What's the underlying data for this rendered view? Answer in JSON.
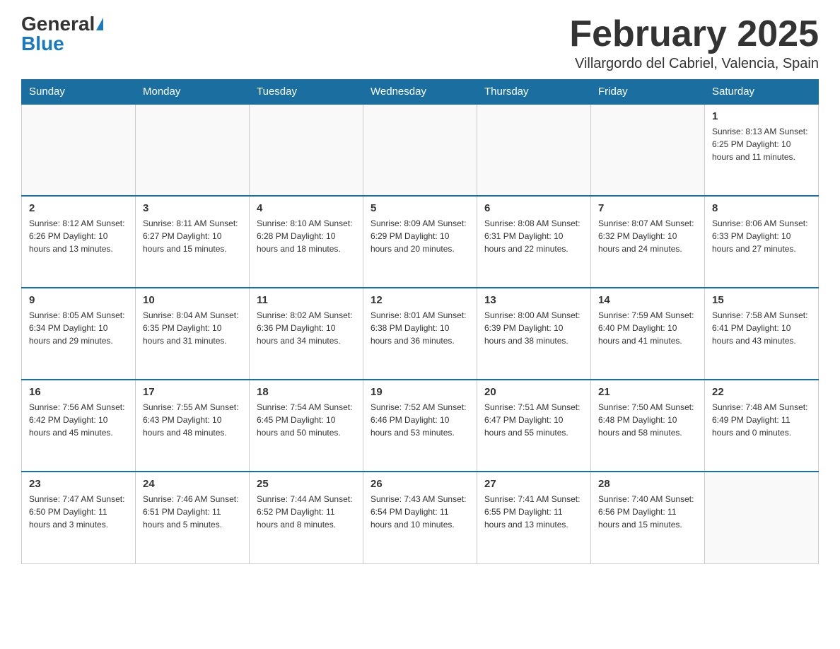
{
  "header": {
    "logo_general": "General",
    "logo_blue": "Blue",
    "month_title": "February 2025",
    "location": "Villargordo del Cabriel, Valencia, Spain"
  },
  "weekdays": [
    "Sunday",
    "Monday",
    "Tuesday",
    "Wednesday",
    "Thursday",
    "Friday",
    "Saturday"
  ],
  "weeks": [
    [
      {
        "day": "",
        "info": ""
      },
      {
        "day": "",
        "info": ""
      },
      {
        "day": "",
        "info": ""
      },
      {
        "day": "",
        "info": ""
      },
      {
        "day": "",
        "info": ""
      },
      {
        "day": "",
        "info": ""
      },
      {
        "day": "1",
        "info": "Sunrise: 8:13 AM\nSunset: 6:25 PM\nDaylight: 10 hours and 11 minutes."
      }
    ],
    [
      {
        "day": "2",
        "info": "Sunrise: 8:12 AM\nSunset: 6:26 PM\nDaylight: 10 hours and 13 minutes."
      },
      {
        "day": "3",
        "info": "Sunrise: 8:11 AM\nSunset: 6:27 PM\nDaylight: 10 hours and 15 minutes."
      },
      {
        "day": "4",
        "info": "Sunrise: 8:10 AM\nSunset: 6:28 PM\nDaylight: 10 hours and 18 minutes."
      },
      {
        "day": "5",
        "info": "Sunrise: 8:09 AM\nSunset: 6:29 PM\nDaylight: 10 hours and 20 minutes."
      },
      {
        "day": "6",
        "info": "Sunrise: 8:08 AM\nSunset: 6:31 PM\nDaylight: 10 hours and 22 minutes."
      },
      {
        "day": "7",
        "info": "Sunrise: 8:07 AM\nSunset: 6:32 PM\nDaylight: 10 hours and 24 minutes."
      },
      {
        "day": "8",
        "info": "Sunrise: 8:06 AM\nSunset: 6:33 PM\nDaylight: 10 hours and 27 minutes."
      }
    ],
    [
      {
        "day": "9",
        "info": "Sunrise: 8:05 AM\nSunset: 6:34 PM\nDaylight: 10 hours and 29 minutes."
      },
      {
        "day": "10",
        "info": "Sunrise: 8:04 AM\nSunset: 6:35 PM\nDaylight: 10 hours and 31 minutes."
      },
      {
        "day": "11",
        "info": "Sunrise: 8:02 AM\nSunset: 6:36 PM\nDaylight: 10 hours and 34 minutes."
      },
      {
        "day": "12",
        "info": "Sunrise: 8:01 AM\nSunset: 6:38 PM\nDaylight: 10 hours and 36 minutes."
      },
      {
        "day": "13",
        "info": "Sunrise: 8:00 AM\nSunset: 6:39 PM\nDaylight: 10 hours and 38 minutes."
      },
      {
        "day": "14",
        "info": "Sunrise: 7:59 AM\nSunset: 6:40 PM\nDaylight: 10 hours and 41 minutes."
      },
      {
        "day": "15",
        "info": "Sunrise: 7:58 AM\nSunset: 6:41 PM\nDaylight: 10 hours and 43 minutes."
      }
    ],
    [
      {
        "day": "16",
        "info": "Sunrise: 7:56 AM\nSunset: 6:42 PM\nDaylight: 10 hours and 45 minutes."
      },
      {
        "day": "17",
        "info": "Sunrise: 7:55 AM\nSunset: 6:43 PM\nDaylight: 10 hours and 48 minutes."
      },
      {
        "day": "18",
        "info": "Sunrise: 7:54 AM\nSunset: 6:45 PM\nDaylight: 10 hours and 50 minutes."
      },
      {
        "day": "19",
        "info": "Sunrise: 7:52 AM\nSunset: 6:46 PM\nDaylight: 10 hours and 53 minutes."
      },
      {
        "day": "20",
        "info": "Sunrise: 7:51 AM\nSunset: 6:47 PM\nDaylight: 10 hours and 55 minutes."
      },
      {
        "day": "21",
        "info": "Sunrise: 7:50 AM\nSunset: 6:48 PM\nDaylight: 10 hours and 58 minutes."
      },
      {
        "day": "22",
        "info": "Sunrise: 7:48 AM\nSunset: 6:49 PM\nDaylight: 11 hours and 0 minutes."
      }
    ],
    [
      {
        "day": "23",
        "info": "Sunrise: 7:47 AM\nSunset: 6:50 PM\nDaylight: 11 hours and 3 minutes."
      },
      {
        "day": "24",
        "info": "Sunrise: 7:46 AM\nSunset: 6:51 PM\nDaylight: 11 hours and 5 minutes."
      },
      {
        "day": "25",
        "info": "Sunrise: 7:44 AM\nSunset: 6:52 PM\nDaylight: 11 hours and 8 minutes."
      },
      {
        "day": "26",
        "info": "Sunrise: 7:43 AM\nSunset: 6:54 PM\nDaylight: 11 hours and 10 minutes."
      },
      {
        "day": "27",
        "info": "Sunrise: 7:41 AM\nSunset: 6:55 PM\nDaylight: 11 hours and 13 minutes."
      },
      {
        "day": "28",
        "info": "Sunrise: 7:40 AM\nSunset: 6:56 PM\nDaylight: 11 hours and 15 minutes."
      },
      {
        "day": "",
        "info": ""
      }
    ]
  ]
}
